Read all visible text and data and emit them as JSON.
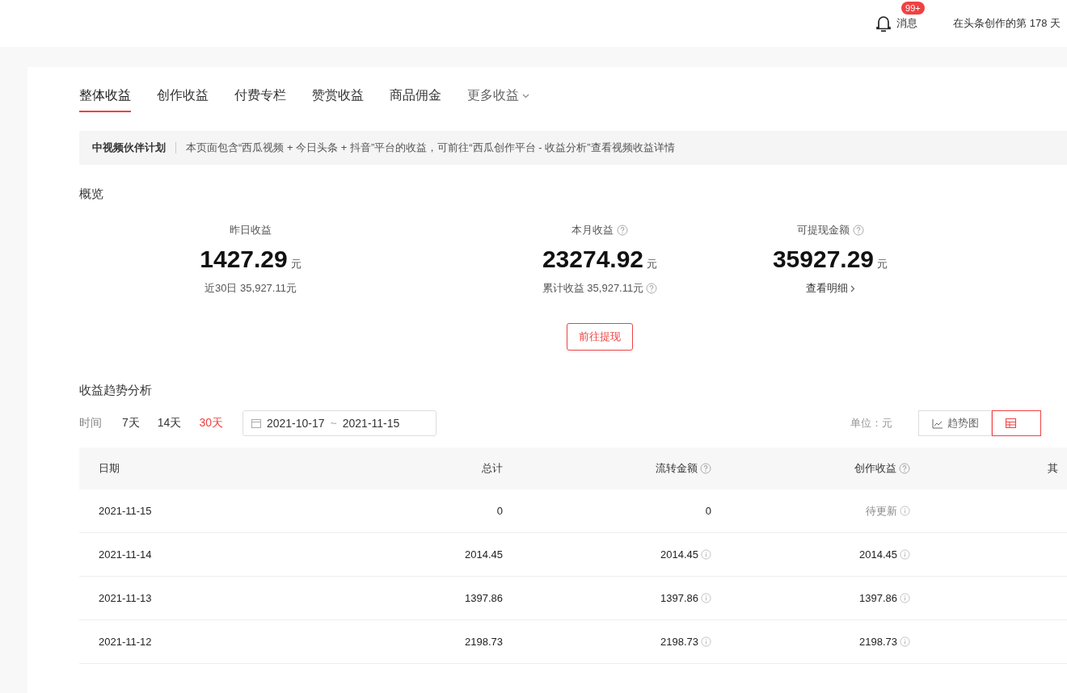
{
  "header": {
    "messages": {
      "label": "消息",
      "badge": "99+"
    },
    "days_text": "在头条创作的第 178 天"
  },
  "tabs": [
    {
      "label": "整体收益",
      "selected": true,
      "kind": "plain"
    },
    {
      "label": "创作收益",
      "selected": false,
      "kind": "plain"
    },
    {
      "label": "付费专栏",
      "selected": false,
      "kind": "plain"
    },
    {
      "label": "赞赏收益",
      "selected": false,
      "kind": "plain"
    },
    {
      "label": "商品佣金",
      "selected": false,
      "kind": "plain"
    },
    {
      "label": "更多收益",
      "selected": false,
      "kind": "dropdown"
    }
  ],
  "notice": {
    "title": "中视频伙伴计划",
    "text": "本页面包含“西瓜视频 + 今日头条 + 抖音”平台的收益，可前往“西瓜创作平台 - 收益分析”查看视频收益详情"
  },
  "overview": {
    "title": "概览",
    "stats": [
      {
        "label": "昨日收益",
        "help": false,
        "value": "1427.29",
        "unit": "元",
        "sub": {
          "text": "近30日 35,927.11元",
          "kind": "text",
          "help": false
        }
      },
      {
        "label": "本月收益",
        "help": true,
        "value": "23274.92",
        "unit": "元",
        "sub": {
          "text": "累计收益 35,927.11元",
          "kind": "text",
          "help": true
        }
      },
      {
        "label": "可提现金额",
        "help": true,
        "value": "35927.29",
        "unit": "元",
        "sub": {
          "text": "查看明细",
          "kind": "link",
          "help": false
        }
      }
    ],
    "withdraw_button": "前往提现"
  },
  "trend": {
    "title": "收益趋势分析",
    "filter_label": "时间",
    "ranges": [
      {
        "label": "7天",
        "selected": false
      },
      {
        "label": "14天",
        "selected": false
      },
      {
        "label": "30天",
        "selected": true
      }
    ],
    "date_range": {
      "start": "2021-10-17",
      "separator": "~",
      "end": "2021-11-15"
    },
    "unit_label": "单位：元",
    "views": [
      {
        "label": "趋势图",
        "kind": "line",
        "selected": false
      },
      {
        "kind": "table",
        "selected": true
      }
    ]
  },
  "table": {
    "columns": [
      {
        "label": "日期",
        "help": false
      },
      {
        "label": "总计",
        "help": false
      },
      {
        "label": "流转金额",
        "help": true
      },
      {
        "label": "创作收益",
        "help": true
      },
      {
        "label": "其",
        "help": false
      }
    ],
    "rows": [
      {
        "cells": [
          {
            "text": "2021-11-15"
          },
          {
            "text": "0"
          },
          {
            "text": "0",
            "info": false
          },
          {
            "text": "待更新",
            "info": true,
            "muted": true
          }
        ]
      },
      {
        "cells": [
          {
            "text": "2021-11-14"
          },
          {
            "text": "2014.45"
          },
          {
            "text": "2014.45",
            "info": true
          },
          {
            "text": "2014.45",
            "info": true,
            "muted": false
          }
        ]
      },
      {
        "cells": [
          {
            "text": "2021-11-13"
          },
          {
            "text": "1397.86"
          },
          {
            "text": "1397.86",
            "info": true
          },
          {
            "text": "1397.86",
            "info": true,
            "muted": false
          }
        ]
      },
      {
        "cells": [
          {
            "text": "2021-11-12"
          },
          {
            "text": "2198.73"
          },
          {
            "text": "2198.73",
            "info": true
          },
          {
            "text": "2198.73",
            "info": true,
            "muted": false
          }
        ]
      }
    ]
  }
}
